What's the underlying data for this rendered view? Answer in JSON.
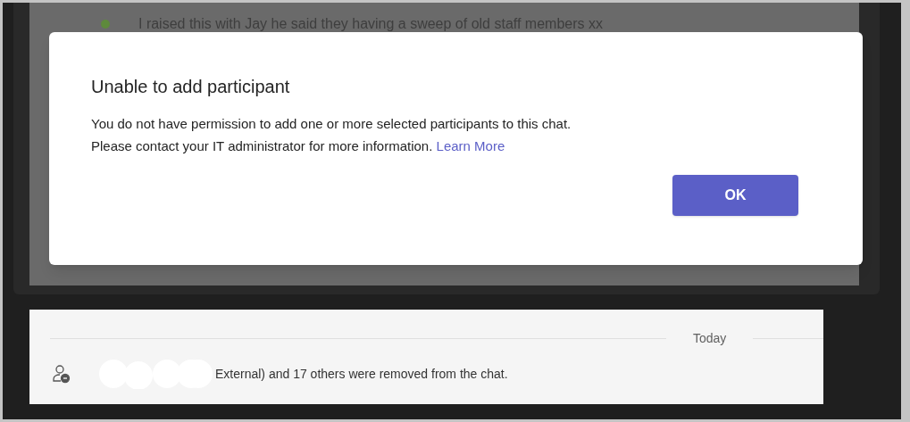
{
  "chat_message": {
    "text": "I raised this with Jay he said they having a sweep of old staff members xx"
  },
  "dialog": {
    "title": "Unable to add participant",
    "message": "You do not have permission to add one or more selected participants to this chat.\nPlease contact your IT administrator for more information.",
    "link": "Learn More",
    "buttons": [
      "OK"
    ]
  },
  "event_divider": "Today",
  "event": {
    "text": "External) and 17 others were removed from the chat."
  }
}
